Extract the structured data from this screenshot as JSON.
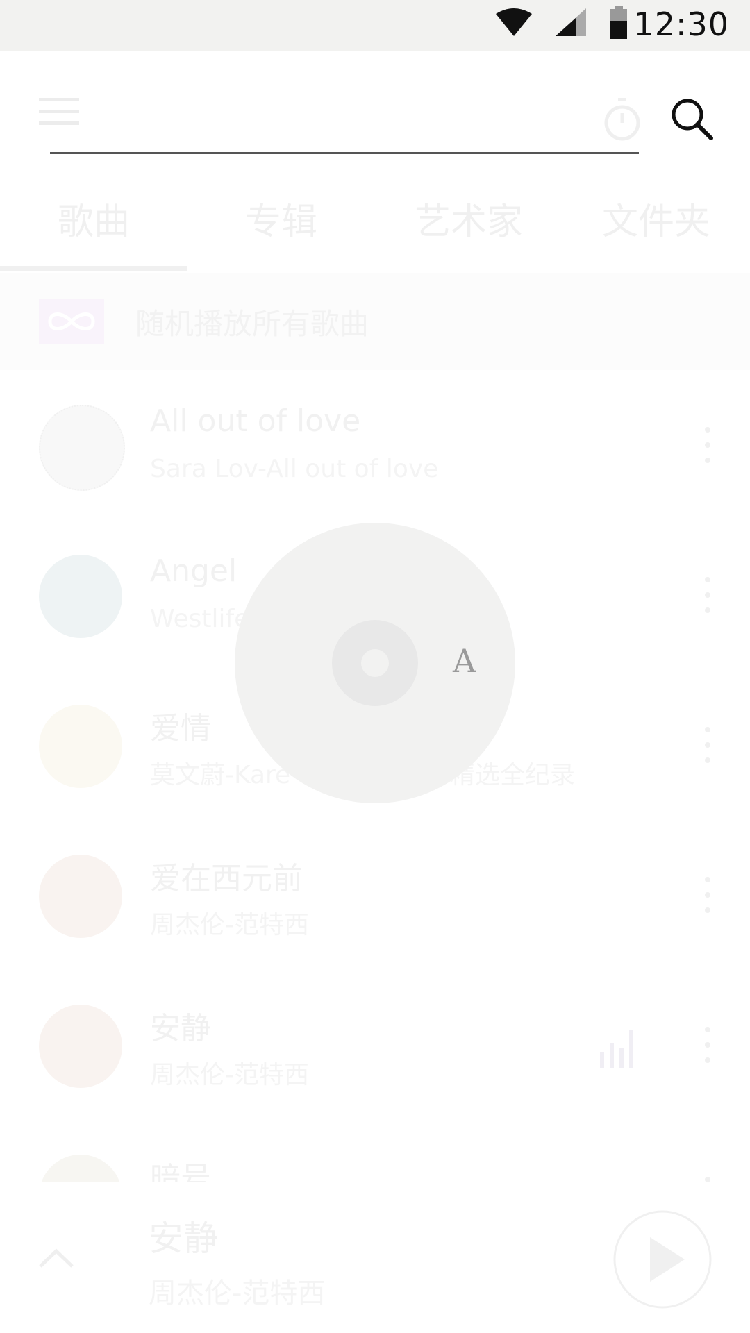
{
  "status_bar": {
    "time": "12:30",
    "icons": [
      "wifi-icon",
      "signal-icon",
      "battery-icon"
    ]
  },
  "toolbar": {
    "icons": [
      "menu-icon",
      "timer-icon",
      "search-icon"
    ],
    "search_value": ""
  },
  "tabs": [
    {
      "label": "歌曲",
      "selected": true
    },
    {
      "label": "专辑",
      "selected": false
    },
    {
      "label": "艺术家",
      "selected": false
    },
    {
      "label": "文件夹",
      "selected": false
    }
  ],
  "shuffle": {
    "label": "随机播放所有歌曲",
    "icon": "shuffle-infinity-icon"
  },
  "songs": [
    {
      "title": "All out of love",
      "subtitle": "Sara Lov-All out of love",
      "playing": false
    },
    {
      "title": "Angel",
      "subtitle": "Westlife",
      "playing": false
    },
    {
      "title": "爱情",
      "subtitle": "莫文蔚-Kare",
      "subtitle_right": "精选全纪录",
      "playing": false
    },
    {
      "title": "爱在西元前",
      "subtitle": "周杰伦-范特西",
      "playing": false
    },
    {
      "title": "安静",
      "subtitle": "周杰伦-范特西",
      "playing": true
    },
    {
      "title": "暗号",
      "subtitle": "",
      "playing": false
    }
  ],
  "index_popup": {
    "letter": "A"
  },
  "now_playing": {
    "title": "安静",
    "subtitle": "周杰伦-范特西",
    "icons": [
      "expand-up-icon",
      "play-icon"
    ]
  },
  "colors": {
    "status_bar_bg": "#f2f2f0",
    "faded_text": "#f1f1f1",
    "disc_bg": "#f2f2f1",
    "disc_ring": "#e8e8e8",
    "disc_letter": "#9a9a9a"
  }
}
